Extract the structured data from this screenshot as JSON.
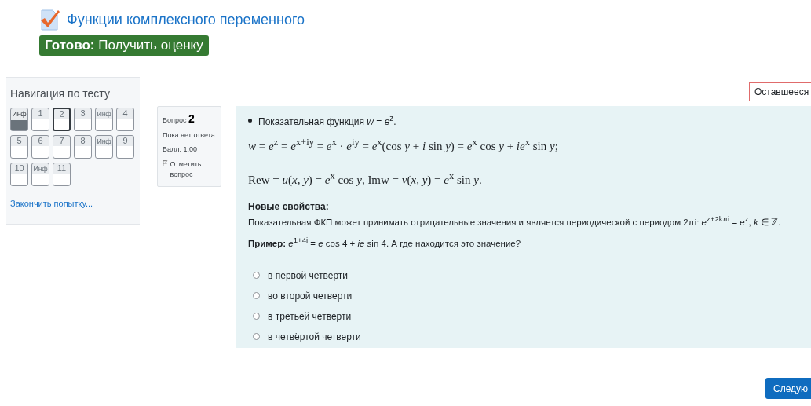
{
  "header": {
    "title": "Функции комплексного переменного",
    "badge_bold": "Готово:",
    "badge_text": "Получить оценку"
  },
  "navigation": {
    "title": "Навигация по тесту",
    "items": [
      {
        "label": "Инф",
        "kind": "info",
        "selected": false,
        "viewed": true
      },
      {
        "label": "1",
        "kind": "question",
        "selected": false,
        "viewed": false
      },
      {
        "label": "2",
        "kind": "question",
        "selected": true,
        "viewed": false
      },
      {
        "label": "3",
        "kind": "question",
        "selected": false,
        "viewed": false
      },
      {
        "label": "Инф",
        "kind": "info",
        "selected": false,
        "viewed": false
      },
      {
        "label": "4",
        "kind": "question",
        "selected": false,
        "viewed": false
      },
      {
        "label": "5",
        "kind": "question",
        "selected": false,
        "viewed": false
      },
      {
        "label": "6",
        "kind": "question",
        "selected": false,
        "viewed": false
      },
      {
        "label": "7",
        "kind": "question",
        "selected": false,
        "viewed": false
      },
      {
        "label": "8",
        "kind": "question",
        "selected": false,
        "viewed": false
      },
      {
        "label": "Инф",
        "kind": "info",
        "selected": false,
        "viewed": false
      },
      {
        "label": "9",
        "kind": "question",
        "selected": false,
        "viewed": false
      },
      {
        "label": "10",
        "kind": "question",
        "selected": false,
        "viewed": false
      },
      {
        "label": "Инф",
        "kind": "info",
        "selected": false,
        "viewed": false
      },
      {
        "label": "11",
        "kind": "question",
        "selected": false,
        "viewed": false
      }
    ],
    "finish_link": "Закончить попытку..."
  },
  "timer": {
    "label": "Оставшееся"
  },
  "question_info": {
    "label": "Вопрос",
    "number": "2",
    "status": "Пока нет ответа",
    "score": "Балл: 1,00",
    "flag": "Отметить вопрос"
  },
  "question": {
    "blocks": [
      {
        "kind": "bullet",
        "text": "Показательная функция *w* = *e*$^{z}$."
      },
      {
        "kind": "math",
        "text": "*w* = *e*$^{z}$ = *e*$^{x+iy}$ = *e*$^{x}$ · *e*$^{iy}$ = *e*$^{x}$(cos *y* + *i* sin *y*) = *e*$^{x}$ cos *y* + *ie*$^{x}$ sin *y*;"
      },
      {
        "kind": "math",
        "text": "Rew = *u*(*x*, *y*) = *e*$^{x}$ cos *y*,  Imw = *v*(*x*, *y*) = *e*$^{x}$ sin *y*."
      },
      {
        "kind": "heading",
        "text": "Новые свойства:"
      },
      {
        "kind": "paragraph",
        "text": "Показательная ФКП может принимать отрицательные значения и является периодической с периодом 2πi: *e*$^{z+2kπi}$ = *e*$^{z}$,   *k* ∈ ℤ."
      },
      {
        "kind": "paragraph",
        "text": "**Пример:** *e*$^{1+4i}$ = *e* cos 4 + *ie* sin 4. А где находится это значение?"
      }
    ],
    "options": [
      {
        "label": "в первой  четверти",
        "selected": false
      },
      {
        "label": "во второй четверти",
        "selected": false
      },
      {
        "label": "в третьей четверти",
        "selected": false
      },
      {
        "label": "в четвёртой четверти",
        "selected": false
      }
    ]
  },
  "next_button": "Следую"
}
